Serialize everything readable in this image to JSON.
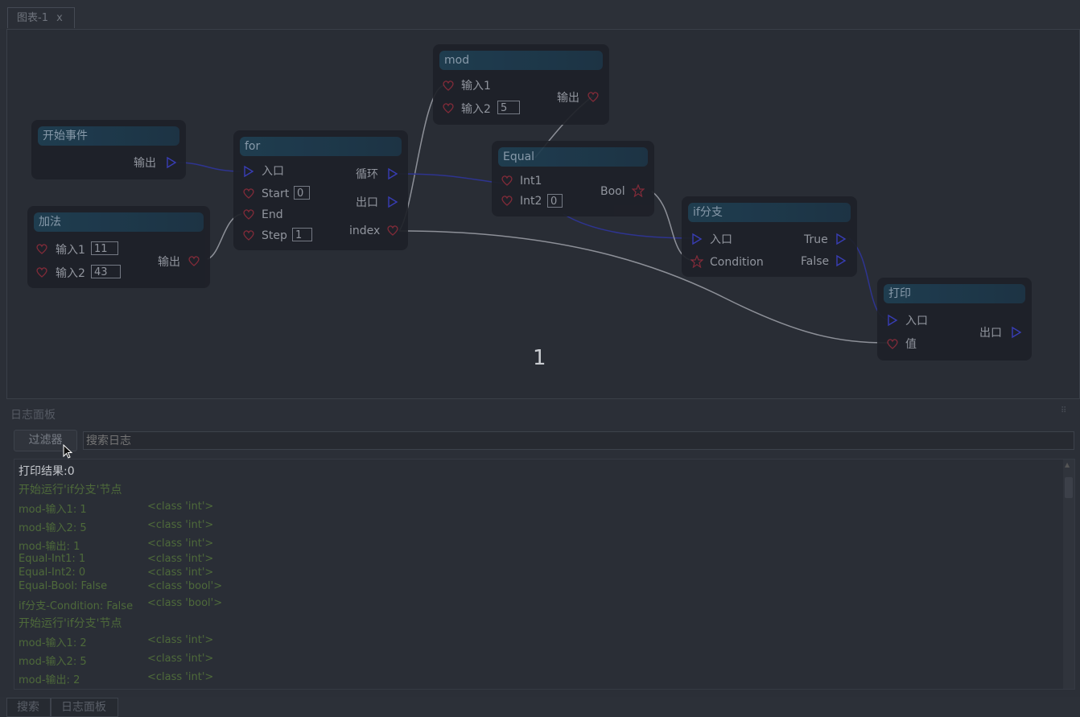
{
  "tab": {
    "title": "图表-1",
    "close": "x"
  },
  "nodes": {
    "start": {
      "title": "开始事件",
      "out": "输出"
    },
    "add": {
      "title": "加法",
      "in1": "输入1",
      "in1_val": "11",
      "in2": "输入2",
      "in2_val": "43",
      "out": "输出"
    },
    "for": {
      "title": "for",
      "entry": "入口",
      "start": "Start",
      "start_val": "0",
      "end": "End",
      "step": "Step",
      "step_val": "1",
      "loop": "循环",
      "exit": "出口",
      "index": "index"
    },
    "mod": {
      "title": "mod",
      "in1": "输入1",
      "in2": "输入2",
      "in2_val": "5",
      "out": "输出"
    },
    "equal": {
      "title": "Equal",
      "int1": "Int1",
      "int2": "Int2",
      "int2_val": "0",
      "bool": "Bool"
    },
    "if": {
      "title": "if分支",
      "entry": "入口",
      "cond": "Condition",
      "true": "True",
      "false": "False"
    },
    "print": {
      "title": "打印",
      "entry": "入口",
      "value": "值",
      "exit": "出口"
    }
  },
  "canvas_number": "1",
  "log_panel": {
    "title": "日志面板",
    "filter_label": "过滤器",
    "search_placeholder": "搜索日志",
    "lines": [
      {
        "text": "打印结果:0",
        "type": ""
      },
      {
        "text": "开始运行'if分支'节点",
        "type": ""
      },
      {
        "text": "mod-输入1: 1",
        "type": "<class 'int'>"
      },
      {
        "text": "mod-输入2: 5",
        "type": "<class 'int'>"
      },
      {
        "text": "mod-输出: 1",
        "type": "<class 'int'>"
      },
      {
        "text": "Equal-Int1: 1",
        "type": "<class 'int'>"
      },
      {
        "text": "Equal-Int2: 0",
        "type": "<class 'int'>"
      },
      {
        "text": "Equal-Bool: False",
        "type": "<class 'bool'>"
      },
      {
        "text": "if分支-Condition: False",
        "type": "<class 'bool'>"
      },
      {
        "text": "开始运行'if分支'节点",
        "type": ""
      },
      {
        "text": "mod-输入1: 2",
        "type": "<class 'int'>"
      },
      {
        "text": "mod-输入2: 5",
        "type": "<class 'int'>"
      },
      {
        "text": "mod-输出: 2",
        "type": "<class 'int'>"
      }
    ]
  },
  "bottom_tabs": [
    "搜索",
    "日志面板"
  ],
  "colors": {
    "exec_pin": "#3a3fc0",
    "data_pin": "#8a2b3a",
    "header": "#1f3f52",
    "exec_wire": "#2e3490",
    "data_wire": "#8d9098"
  }
}
